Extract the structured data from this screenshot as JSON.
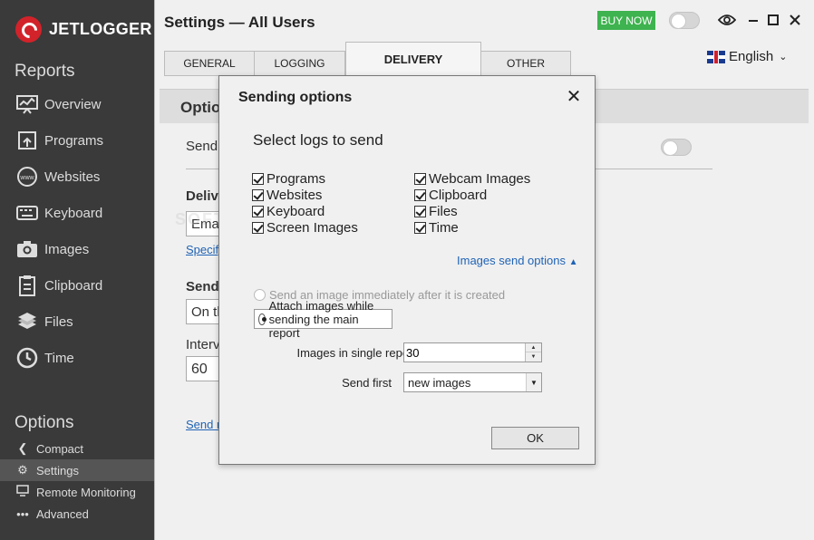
{
  "app": {
    "name": "JETLOGGER"
  },
  "sidebar": {
    "reports_title": "Reports",
    "reports": [
      {
        "label": "Overview",
        "icon": "overview-icon"
      },
      {
        "label": "Programs",
        "icon": "programs-icon"
      },
      {
        "label": "Websites",
        "icon": "websites-icon"
      },
      {
        "label": "Keyboard",
        "icon": "keyboard-icon"
      },
      {
        "label": "Images",
        "icon": "camera-icon"
      },
      {
        "label": "Clipboard",
        "icon": "clipboard-icon"
      },
      {
        "label": "Files",
        "icon": "files-icon"
      },
      {
        "label": "Time",
        "icon": "clock-icon"
      }
    ],
    "options_title": "Options",
    "options": [
      {
        "label": "Compact",
        "icon": "chevron-left-icon"
      },
      {
        "label": "Settings",
        "icon": "gear-icon",
        "active": true
      },
      {
        "label": "Remote Monitoring",
        "icon": "monitor-icon"
      },
      {
        "label": "Advanced",
        "icon": "more-dots-icon"
      }
    ]
  },
  "header": {
    "title": "Settings — All Users",
    "buy_label": "BUY NOW",
    "language": "English"
  },
  "tabs": [
    {
      "label": "GENERAL",
      "active": false
    },
    {
      "label": "LOGGING",
      "active": false
    },
    {
      "label": "DELIVERY",
      "active": true
    },
    {
      "label": "OTHER",
      "active": false
    }
  ],
  "background": {
    "options_heading": "Optio",
    "send_label": "Send",
    "delivery_heading": "Deliv",
    "email_value": "Emai",
    "specify_link": "Specify",
    "send2_heading": "Send",
    "on_value": "On th",
    "interval_label": "Interv",
    "interval_value": "60",
    "send_link": "Send r"
  },
  "dialog": {
    "title": "Sending options",
    "subtitle": "Select logs to send",
    "checkboxes_left": [
      "Programs",
      "Websites",
      "Keyboard",
      "Screen Images"
    ],
    "checkboxes_right": [
      "Webcam Images",
      "Clipboard",
      "Files",
      "Time"
    ],
    "images_send_options": "Images send options",
    "radio_immediate": "Send an image immediately after it is created",
    "radio_attach": "Attach images while sending the main report",
    "images_in_report_label": "Images in single report",
    "images_in_report_value": "30",
    "send_first_label": "Send first",
    "send_first_value": "new images",
    "ok_label": "OK"
  },
  "watermark": "SOFTPEDIA",
  "colors": {
    "sidebar": "#3a3a3a",
    "buy": "#3eb34f",
    "link": "#1f63b5",
    "logo": "#d2232a"
  }
}
